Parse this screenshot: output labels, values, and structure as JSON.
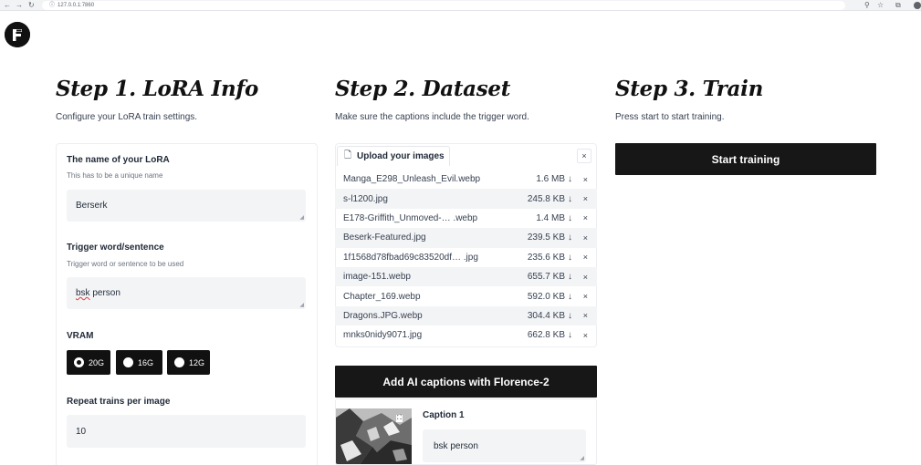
{
  "browser": {
    "url": "127.0.0.1:7860"
  },
  "steps": [
    {
      "title": "Step 1. LoRA Info",
      "subtitle": "Configure your LoRA train settings."
    },
    {
      "title": "Step 2. Dataset",
      "subtitle": "Make sure the captions include the trigger word."
    },
    {
      "title": "Step 3. Train",
      "subtitle": "Press start to start training."
    }
  ],
  "lora_info": {
    "name_label": "The name of your LoRA",
    "name_info": "This has to be a unique name",
    "name_value": "Berserk",
    "trigger_label": "Trigger word/sentence",
    "trigger_info": "Trigger word or sentence to be used",
    "trigger_value_word": "bsk",
    "trigger_value_rest": " person",
    "vram_label": "VRAM",
    "vram_options": [
      "20G",
      "16G",
      "12G"
    ],
    "vram_selected": "20G",
    "repeat_label": "Repeat trains per image",
    "repeat_value": "10"
  },
  "dataset": {
    "upload_label": "Upload your images",
    "files": [
      {
        "name": "Manga_E298_Unleash_Evil.webp",
        "size": "1.6 MB"
      },
      {
        "name": "s-l1200.jpg",
        "size": "245.8 KB"
      },
      {
        "name": "E178-Griffith_Unmoved-… .webp",
        "size": "1.4 MB"
      },
      {
        "name": "Beserk-Featured.jpg",
        "size": "239.5 KB"
      },
      {
        "name": "1f1568d78fbad69c83520df… .jpg",
        "size": "235.6 KB"
      },
      {
        "name": "image-151.webp",
        "size": "655.7 KB"
      },
      {
        "name": "Chapter_169.webp",
        "size": "592.0 KB"
      },
      {
        "name": "Dragons.JPG.webp",
        "size": "304.4 KB"
      },
      {
        "name": "mnks0nidy9071.jpg",
        "size": "662.8 KB"
      }
    ],
    "caption_button": "Add AI captions with Florence-2",
    "caption_label": "Caption 1",
    "caption_value": "bsk person"
  },
  "train": {
    "start_button": "Start training"
  },
  "icons": {
    "download": "↓",
    "remove": "×",
    "clear": "×",
    "file": "file-icon",
    "logo": "f-logo-icon"
  }
}
